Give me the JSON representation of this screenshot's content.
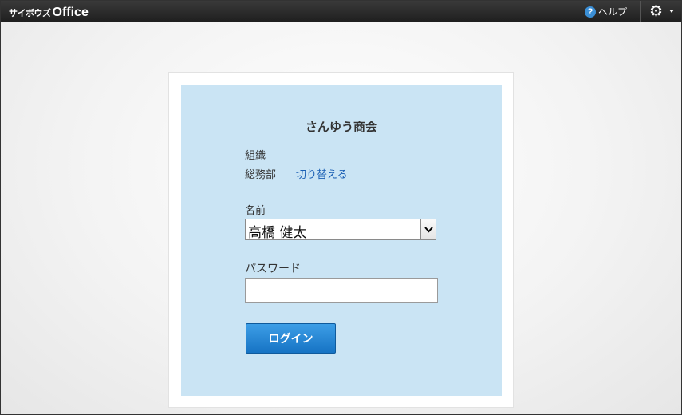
{
  "topbar": {
    "logo_kana": "サイボウズ",
    "logo_office": "Office",
    "help_label": "ヘルプ",
    "help_icon": "question-circle-icon",
    "settings_icon": "gear-icon"
  },
  "login": {
    "company_name": "さんゆう商会",
    "org_label": "組織",
    "org_value": "総務部",
    "switch_link": "切り替える",
    "name_label": "名前",
    "name_value": "高橋 健太",
    "password_label": "パスワード",
    "password_value": "",
    "login_button": "ログイン"
  },
  "colors": {
    "panel_bg": "#cae4f4",
    "button_blue": "#1f82d2",
    "link_blue": "#1a5fb4",
    "topbar_bg": "#2b2b2b"
  }
}
